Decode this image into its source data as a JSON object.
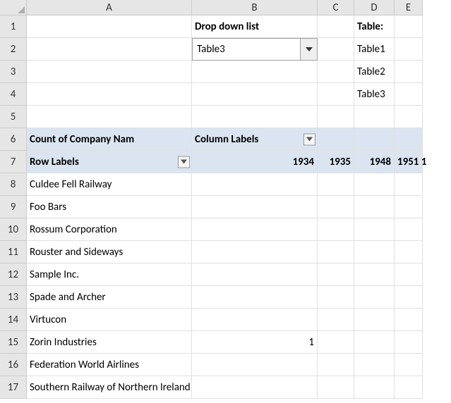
{
  "columns": {
    "letters": [
      "A",
      "B",
      "C",
      "D",
      "E"
    ],
    "widths": [
      234,
      178,
      52,
      57,
      40
    ]
  },
  "rows": {
    "count": 17
  },
  "cells": {
    "b1": "Drop down list",
    "d1": "Table:",
    "b2": "Table3",
    "d2": "Table1",
    "d3": "Table2",
    "d4": "Table3",
    "a6": "Count of Company Nam",
    "b6": "Column Labels",
    "a7": "Row Labels",
    "b7": "1934",
    "c7": "1935",
    "d7": "1948",
    "e7": "1951",
    "f7": "1",
    "a8": "Culdee Fell Railway",
    "a9": "Foo Bars",
    "a10": "Rossum Corporation",
    "a11": "Rouster and Sideways",
    "a12": "Sample Inc.",
    "a13": "Spade and Archer",
    "a14": "Virtucon",
    "a15": "Zorin Industries",
    "b15": "1",
    "a16": "Federation World Airlines",
    "a17": "Southern Railway of Northern Ireland"
  },
  "icons": {
    "dropdown": "chevron-down-icon",
    "filter": "chevron-down-icon"
  }
}
